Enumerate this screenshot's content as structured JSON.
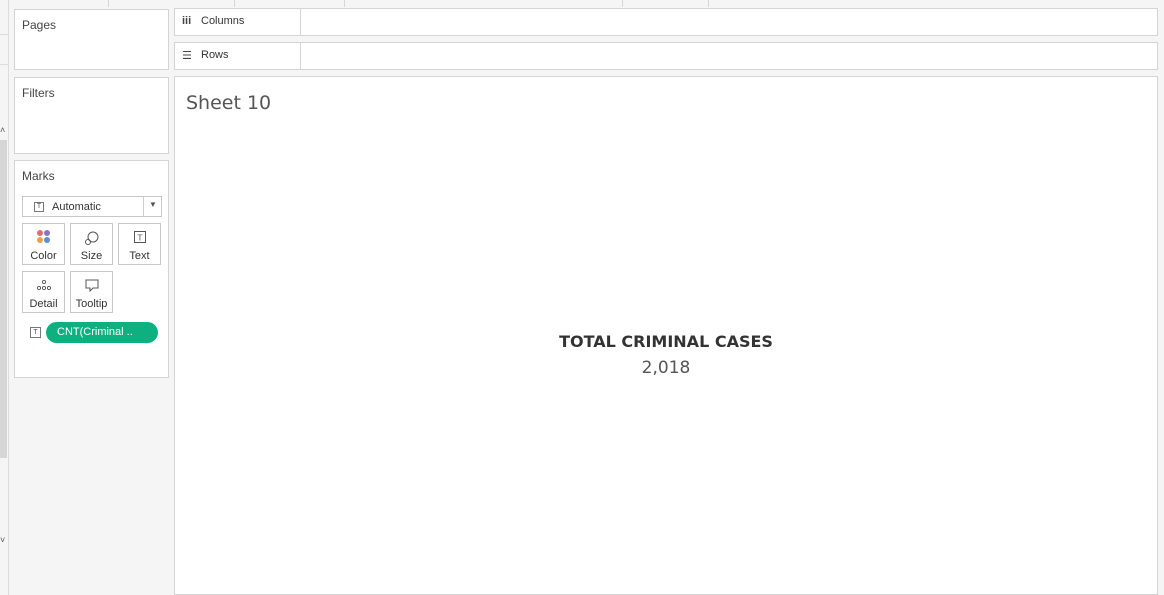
{
  "cards": {
    "pages_title": "Pages",
    "filters_title": "Filters",
    "marks_title": "Marks"
  },
  "marks": {
    "mark_type": "Automatic",
    "buttons": {
      "color": "Color",
      "size": "Size",
      "text": "Text",
      "detail": "Detail",
      "tooltip": "Tooltip"
    },
    "pill_label": "CNT(Criminal ..",
    "pill_color": "#0fb07f"
  },
  "shelves": {
    "columns_label": "Columns",
    "rows_label": "Rows"
  },
  "view": {
    "sheet_title": "Sheet 10",
    "kpi_label": "TOTAL CRIMINAL CASES",
    "kpi_value": "2,018"
  },
  "icons": {
    "columns": "columns-icon",
    "rows": "rows-icon",
    "text_mark": "text-mark-icon",
    "color": "color-dots-icon",
    "size": "size-icon",
    "detail": "detail-icon",
    "tooltip": "tooltip-icon",
    "dropdown": "chevron-down-icon"
  }
}
